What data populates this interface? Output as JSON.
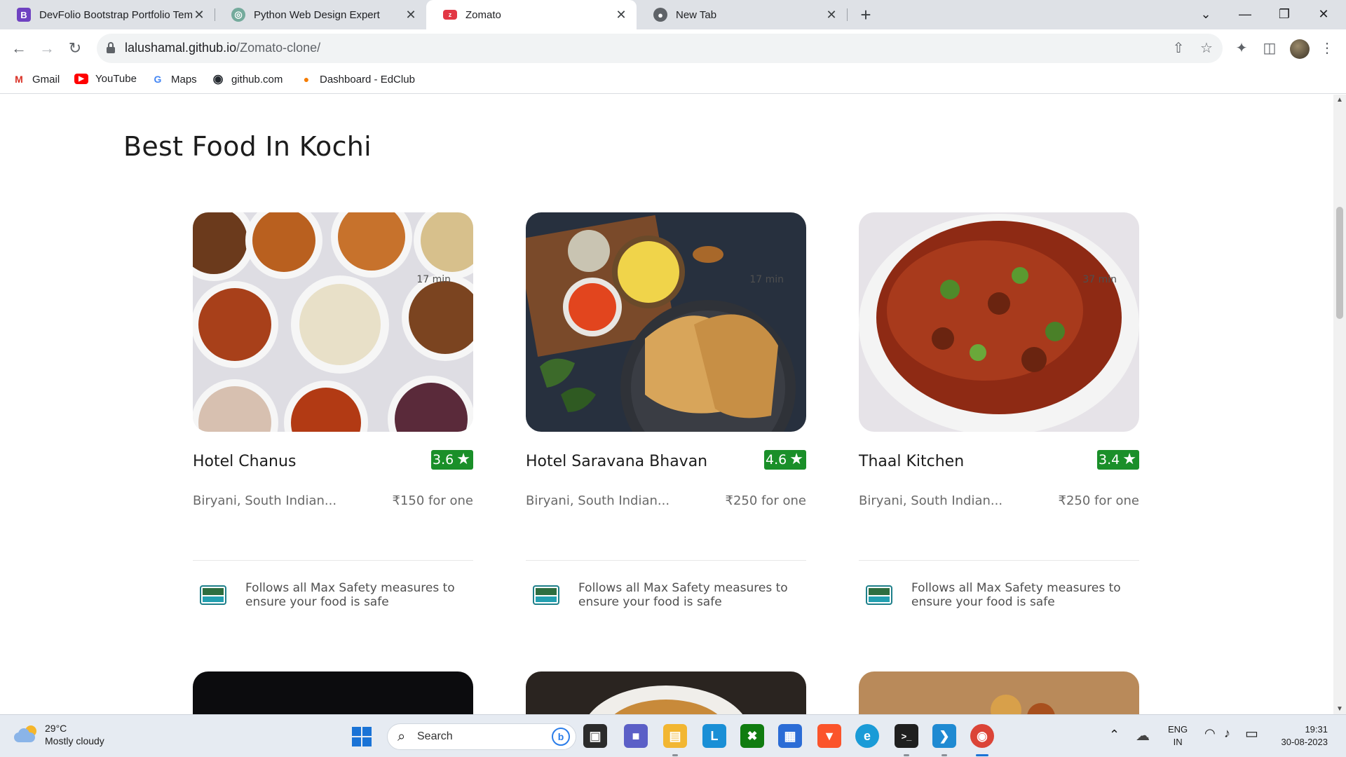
{
  "browser": {
    "tabs": [
      {
        "title": "DevFolio Bootstrap Portfolio Tem",
        "icon_letter": "B",
        "icon_color": "#6f42c1",
        "active": false
      },
      {
        "title": "Python Web Design Expert",
        "icon_letter": "◎",
        "icon_color": "#74aa9c",
        "active": false
      },
      {
        "title": "Zomato",
        "icon_letter": "z",
        "icon_color": "#e23744",
        "active": true
      },
      {
        "title": "New Tab",
        "icon_letter": "●",
        "icon_color": "#5f6368",
        "active": false
      }
    ],
    "close_glyph": "✕",
    "new_tab_glyph": "+",
    "window_controls": {
      "dropdown": "⌄",
      "minimize": "—",
      "restore": "❐",
      "close": "✕"
    },
    "url_host": "lalushamal.github.io",
    "url_path": "/Zomato-clone/",
    "nav": {
      "back": "←",
      "forward": "→",
      "reload": "↻"
    },
    "omni_icons": {
      "share": "⇧",
      "star": "☆"
    },
    "toolbar_icons": {
      "extensions": "✦",
      "sidebar": "◫",
      "menu": "⋮"
    },
    "bookmarks": [
      {
        "label": "Gmail",
        "icon": "M",
        "color": "#d93025"
      },
      {
        "label": "YouTube",
        "icon": "▶",
        "color": "#ff0000"
      },
      {
        "label": "Maps",
        "icon": "G",
        "color": "#4285f4"
      },
      {
        "label": "github.com",
        "icon": "◉",
        "color": "#24292f"
      },
      {
        "label": "Dashboard - EdClub",
        "icon": "●",
        "color": "#f57c00"
      }
    ]
  },
  "page": {
    "section_title": "Best Food In Kochi",
    "restaurants": [
      {
        "name": "Hotel Chanus",
        "rating": "3.6",
        "cuisine": "Biryani, South Indian...",
        "price": "₹150 for one",
        "time": "17 min",
        "safety": "Follows all Max Safety measures to ensure your food is safe"
      },
      {
        "name": "Hotel Saravana Bhavan",
        "rating": "4.6",
        "cuisine": "Biryani, South Indian...",
        "price": "₹250 for one",
        "time": "17 min",
        "safety": "Follows all Max Safety measures to ensure your food is safe"
      },
      {
        "name": "Thaal Kitchen",
        "rating": "3.4",
        "cuisine": "Biryani, South Indian...",
        "price": "₹250 for one",
        "time": "37 min",
        "safety": "Follows all Max Safety measures to ensure your food is safe"
      }
    ],
    "star_glyph": "★",
    "rating_color": "#1a8f29"
  },
  "taskbar": {
    "weather_temp": "29°C",
    "weather_desc": "Mostly cloudy",
    "search_label": "Search",
    "search_glyph": "⌕",
    "bing_glyph": "b",
    "apps": [
      {
        "name": "task-view",
        "glyph": "▣",
        "color": "#2b2b2b"
      },
      {
        "name": "teams",
        "glyph": "■",
        "color": "#5b5fc7"
      },
      {
        "name": "file-explorer",
        "glyph": "▤",
        "color": "#f2b632"
      },
      {
        "name": "l-app",
        "glyph": "L",
        "color": "#1a8fd6"
      },
      {
        "name": "xbox",
        "glyph": "✖",
        "color": "#107c10"
      },
      {
        "name": "ms-store",
        "glyph": "▦",
        "color": "#2b6cd6"
      },
      {
        "name": "brave",
        "glyph": "▼",
        "color": "#fb542b"
      },
      {
        "name": "edge",
        "glyph": "e",
        "color": "#1a9bd7"
      },
      {
        "name": "terminal",
        "glyph": ">_",
        "color": "#1f1f1f"
      },
      {
        "name": "vscode",
        "glyph": "❯",
        "color": "#1f8ad2"
      },
      {
        "name": "chrome",
        "glyph": "◉",
        "color": "#db4437"
      }
    ],
    "tray_chevron": "⌃",
    "tray_cloud": "☁",
    "lang_top": "ENG",
    "lang_bottom": "IN",
    "wifi": "◠",
    "volume": "♪",
    "battery": "▭",
    "time": "19:31",
    "date": "30-08-2023"
  }
}
